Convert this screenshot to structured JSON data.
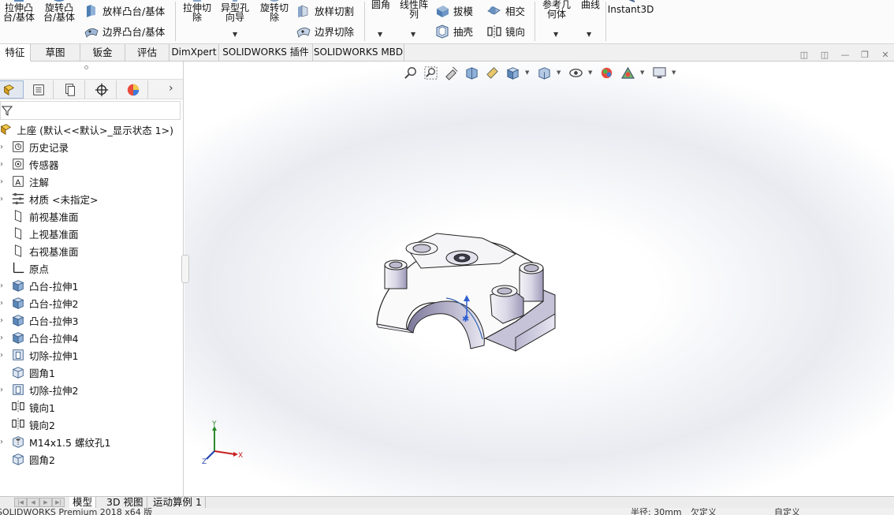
{
  "ribbon": {
    "extrude_boss": "拉伸凸\n台/基体",
    "revolve_boss": "旋转凸\n台/基体",
    "loft_boss": "放样凸台/基体",
    "boundary_boss": "边界凸台/基体",
    "extrude_cut": "拉伸切\n除",
    "hole_wizard": "异型孔\n向导",
    "revolve_cut": "旋转切\n除",
    "loft_cut": "放样切割",
    "boundary_cut": "边界切除",
    "fillet": "圆角",
    "linear_pattern": "线性阵\n列",
    "draft": "拔模",
    "intersect": "相交",
    "shell": "抽壳",
    "mirror": "镜向",
    "ref_geometry": "参考几\n何体",
    "curves": "曲线",
    "instant3d": "Instant3D"
  },
  "tabs": [
    "特征",
    "草图",
    "钣金",
    "评估",
    "DimXpert",
    "SOLIDWORKS 插件",
    "SOLIDWORKS MBD"
  ],
  "feature_tree": {
    "root": "上座 (默认<<默认>_显示状态 1>)",
    "items": [
      {
        "label": "历史记录",
        "icon": "history-icon"
      },
      {
        "label": "传感器",
        "icon": "sensor-icon"
      },
      {
        "label": "注解",
        "icon": "annotation-icon"
      },
      {
        "label": "材质 <未指定>",
        "icon": "material-icon"
      },
      {
        "label": "前视基准面",
        "icon": "plane-icon"
      },
      {
        "label": "上视基准面",
        "icon": "plane-icon"
      },
      {
        "label": "右视基准面",
        "icon": "plane-icon"
      },
      {
        "label": "原点",
        "icon": "origin-icon"
      },
      {
        "label": "凸台-拉伸1",
        "icon": "boss-extrude-icon"
      },
      {
        "label": "凸台-拉伸2",
        "icon": "boss-extrude-icon"
      },
      {
        "label": "凸台-拉伸3",
        "icon": "boss-extrude-icon"
      },
      {
        "label": "凸台-拉伸4",
        "icon": "boss-extrude-icon"
      },
      {
        "label": "切除-拉伸1",
        "icon": "cut-extrude-icon"
      },
      {
        "label": "圆角1",
        "icon": "fillet-icon"
      },
      {
        "label": "切除-拉伸2",
        "icon": "cut-extrude-icon"
      },
      {
        "label": "镜向1",
        "icon": "mirror-icon"
      },
      {
        "label": "镜向2",
        "icon": "mirror-icon"
      },
      {
        "label": "M14x1.5 螺纹孔1",
        "icon": "hole-icon"
      },
      {
        "label": "圆角2",
        "icon": "fillet-icon"
      }
    ]
  },
  "triad": {
    "x": "X",
    "y": "Y",
    "z": "Z"
  },
  "bottom_tabs": [
    "模型",
    "3D 视图",
    "运动算例 1"
  ],
  "status": {
    "left": "SOLIDWORKS Premium 2018 x64 版",
    "mid1": "半径: 30mm",
    "mid2": "欠定义",
    "right": "自定义"
  }
}
